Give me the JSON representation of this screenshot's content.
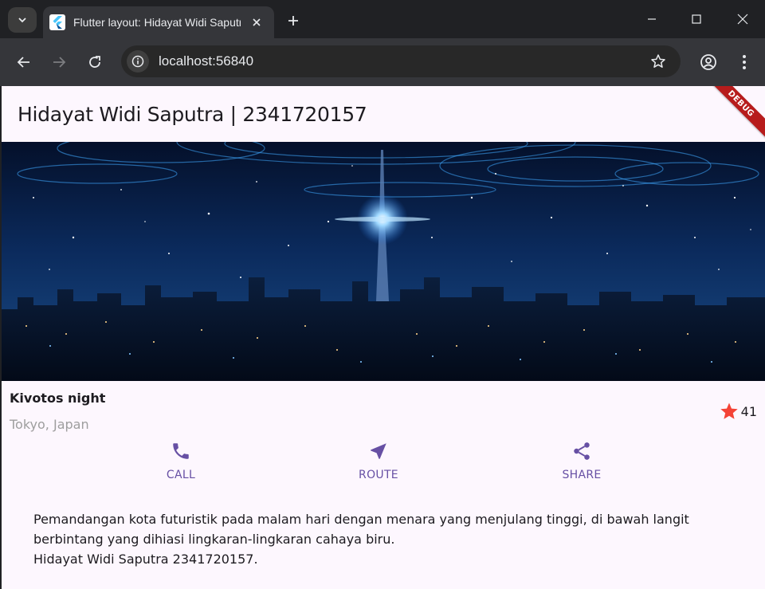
{
  "browser": {
    "tab_title": "Flutter layout: Hidayat Widi Saputra | 2341720157",
    "url": "localhost:56840"
  },
  "app": {
    "appbar_title": "Hidayat Widi Saputra | 2341720157",
    "debug_label": "DEBUG",
    "place_name": "Kivotos night",
    "location": "Tokyo, Japan",
    "rating_count": "41",
    "actions": [
      {
        "label": "CALL",
        "icon": "phone-icon"
      },
      {
        "label": "ROUTE",
        "icon": "near-me-icon"
      },
      {
        "label": "SHARE",
        "icon": "share-icon"
      }
    ],
    "description_line1": "Pemandangan kota futuristik pada malam hari dengan menara yang menjulang tinggi, di bawah langit berbintang yang dihiasi lingkaran-lingkaran cahaya biru.",
    "description_line2": "Hidayat Widi Saputra 2341720157."
  },
  "colors": {
    "accent": "#6750a4",
    "star": "#f44336",
    "app_background": "#fdf7fe"
  }
}
